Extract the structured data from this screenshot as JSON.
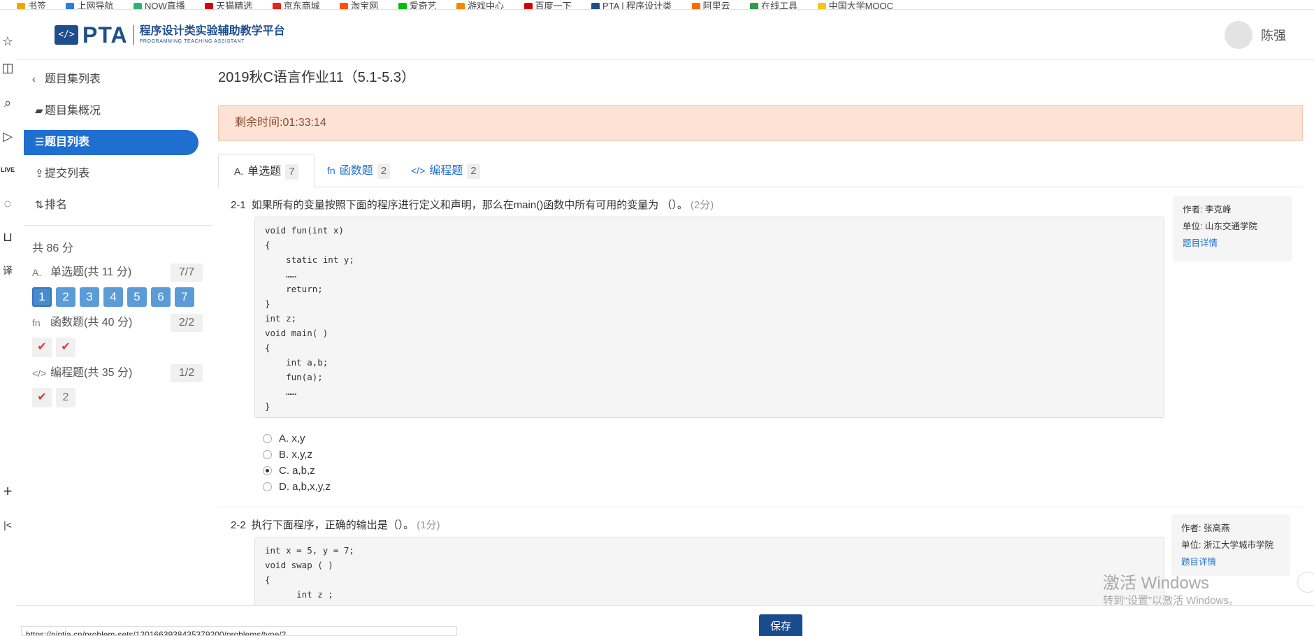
{
  "bookmarks": [
    "书签",
    "上网导航",
    "NOW直播",
    "天猫精选",
    "京东商城",
    "淘宝网",
    "爱奇艺",
    "游戏中心",
    "百度一下",
    "PTA | 程序设计类",
    "阿里云",
    "在线工具",
    "中国大学MOOC"
  ],
  "header": {
    "logo_mark": "</>",
    "logo_text": "PTA",
    "logo_cn": "程序设计类实验辅助教学平台",
    "logo_en": "PROGRAMMING TEACHING ASSISTANT",
    "user_name": "陈强"
  },
  "sidebar": {
    "back": "题目集列表",
    "items": [
      {
        "label": "题目集概况",
        "icon": "book-icon"
      },
      {
        "label": "题目列表",
        "icon": "list-icon",
        "active": true
      },
      {
        "label": "提交列表",
        "icon": "upload-icon"
      },
      {
        "label": "排名",
        "icon": "sort-icon"
      }
    ],
    "total": "共 86 分",
    "sections": [
      {
        "icon": "A.",
        "label": "单选题(共 11 分)",
        "count": "7/7",
        "pills": [
          "1",
          "2",
          "3",
          "4",
          "5",
          "6",
          "7"
        ]
      },
      {
        "icon": "fn",
        "label": "函数题(共 40 分)",
        "count": "2/2",
        "pills": [
          "✔",
          "✔"
        ]
      },
      {
        "icon": "</>",
        "label": "编程题(共 35 分)",
        "count": "1/2",
        "pills": [
          "✔",
          "2"
        ]
      }
    ]
  },
  "main": {
    "title": "2019秋C语言作业11（5.1-5.3）",
    "timer": "剩余时间:01:33:14",
    "tabs": [
      {
        "icon": "A.",
        "label": "单选题",
        "count": "7"
      },
      {
        "icon": "fn",
        "label": "函数题",
        "count": "2"
      },
      {
        "icon": "</>",
        "label": "编程题",
        "count": "2"
      }
    ],
    "questions": [
      {
        "num": "2-1",
        "text": "如果所有的变量按照下面的程序进行定义和声明，那么在main()函数中所有可用的变量为 （）。",
        "score": "(2分)",
        "code": "void fun(int x)\n{\n    static int y;\n    ……\n    return;\n}\nint z;\nvoid main( )\n{\n    int a,b;\n    fun(a);\n    ……\n}",
        "options": [
          "A. x,y",
          "B. x,y,z",
          "C. a,b,z",
          "D. a,b,x,y,z"
        ],
        "selected": 2,
        "author": "作者: 李克峰",
        "unit": "单位: 山东交通学院",
        "detail": "题目详情"
      },
      {
        "num": "2-2",
        "text": "执行下面程序，正确的输出是（）。",
        "score": "(1分)",
        "code": "int x = 5, y = 7;\nvoid swap ( )\n{\n      int z ;",
        "author": "作者: 张高燕",
        "unit": "单位: 浙江大学城市学院",
        "detail": "题目详情"
      }
    ]
  },
  "footer": {
    "save": "保存",
    "url": "https://pintia.cn/problem-sets/1201663938435379200/problems/type/2"
  },
  "watermark": {
    "line1": "激活 Windows",
    "line2": "转到“设置”以激活 Windows。"
  },
  "colors": {
    "brand": "#1f4e8c",
    "active_nav": "#1f6fd0",
    "timer_bg": "#fce3d6",
    "pill_blue": "#5b9bd8",
    "check_red": "#e23838"
  }
}
